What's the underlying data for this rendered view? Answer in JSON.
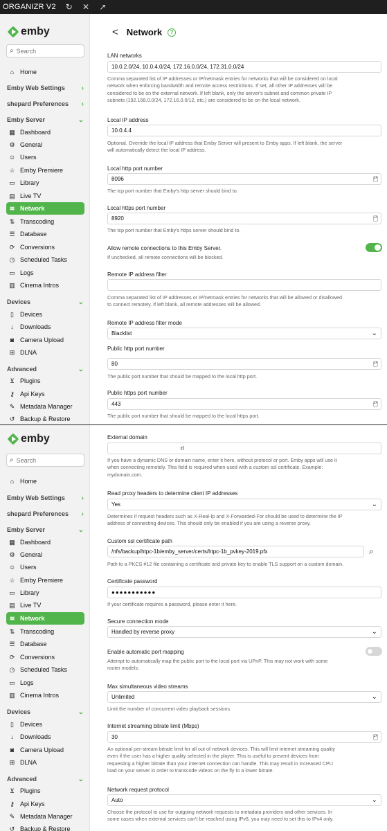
{
  "titlebar": {
    "title": "ORGANIZR V2",
    "reload_icon": "↻",
    "close_icon": "✕",
    "popout_icon": "↗"
  },
  "brand": {
    "name": "emby",
    "color": "#52b54b"
  },
  "search": {
    "placeholder": "Search"
  },
  "nav": {
    "home": "Home",
    "web_settings": "Emby Web Settings",
    "user_prefs": "shepard Preferences",
    "server_header": "Emby Server",
    "dashboard": "Dashboard",
    "general": "General",
    "users": "Users",
    "premiere": "Emby Premiere",
    "library": "Library",
    "livetv": "Live TV",
    "network": "Network",
    "transcoding": "Transcoding",
    "database": "Database",
    "conversions": "Conversions",
    "scheduled": "Scheduled Tasks",
    "logs": "Logs",
    "cinema": "Cinema Intros",
    "devices_header": "Devices",
    "devices": "Devices",
    "downloads": "Downloads",
    "camera": "Camera Upload",
    "dlna": "DLNA",
    "advanced_header": "Advanced",
    "plugins": "Plugins",
    "apikeys": "Api Keys",
    "metadata": "Metadata Manager",
    "backup": "Backup & Restore"
  },
  "page": {
    "title": "Network",
    "back_icon": "<",
    "help_icon": "?"
  },
  "settings": {
    "lan": {
      "label": "LAN networks",
      "value": "10.0.2.0/24, 10.0.4.0/24, 172.16.0.0/24, 172.31.0.0/24",
      "help1": "Comma separated list of IP addresses or IP/netmask entries for networks that will be considered on local",
      "help2": "network when enforcing bandwidth and remote access restrictions. If set, all other IP addresses will be",
      "help3": "considered to be on the external network. If left blank, only the server's subnet and common private IP",
      "help4": "subnets (192.168.0.0/24, 172.16.0.0/12, etc.) are considered to be on the local network."
    },
    "local_ip": {
      "label": "Local IP address",
      "value": "10.0.4.4",
      "help1": "Optional. Override the local IP address that Emby Server will present to Emby apps. If left blank, the server",
      "help2": "will automatically detect the local IP address."
    },
    "http_port": {
      "label": "Local http port number",
      "value": "8096",
      "help": "The tcp port number that Emby's http server should bind to."
    },
    "https_port": {
      "label": "Local https port number",
      "value": "8920",
      "help": "The tcp port number that Emby's https server should bind to."
    },
    "remote": {
      "label": "Allow remote connections to this Emby Server.",
      "help": "If unchecked, all remote connections will be blocked.",
      "enabled": true
    },
    "remote_filter": {
      "label": "Remote IP address filter",
      "value": "",
      "help1": "Comma separated list of IP addresses or IP/netmask entries for networks that will be allowed or disallowed",
      "help2": "to connect remotely. If left blank, all remote addresses will be allowed."
    },
    "filter_mode": {
      "label": "Remote IP address filter mode",
      "value": "Blacklist"
    },
    "public_http": {
      "label": "Public http port number",
      "value": "80",
      "help": "The public port number that should be mapped to the local http port."
    },
    "public_https": {
      "label": "Public https port number",
      "value": "443",
      "help": "The public port number that should be mapped to the local https port."
    },
    "domain": {
      "label": "External domain",
      "value": "rl",
      "help1": "If you have a dynamic DNS or domain name, enter it here, without protocol or port. Emby apps will use it",
      "help2": "when connecting remotely. This field is required when used with a custom ssl certificate. Example:",
      "help3": "mydomain.com."
    },
    "proxy_headers": {
      "label": "Read proxy headers to determine client IP addresses",
      "value": "Yes",
      "help1": "Determines if request headers such as X-Real-Ip and X-Forwarded-For should be used to determine the IP",
      "help2": "address of connecting devices. This should only be enabled if you are using a reverse proxy."
    },
    "ssl_path": {
      "label": "Custom ssl certificate path",
      "value": "/nfs/backup/htpc-1b/emby_server/certs/htpc-1b_pvkey-2019.pfx",
      "help": "Path to a PKCS #12 file containing a certificate and private key to enable TLS support on a custom domain."
    },
    "cert_password": {
      "label": "Certificate password",
      "value": "●●●●●●●●●●●",
      "help": "If your certificate requires a password, please enter it here."
    },
    "secure_mode": {
      "label": "Secure connection mode",
      "value": "Handled by reverse proxy"
    },
    "port_mapping": {
      "label": "Enable automatic port mapping",
      "help1": "Attempt to automatically map the public port to the local port via UPnP. This may not work with some",
      "help2": "router models.",
      "enabled": false
    },
    "max_streams": {
      "label": "Max simultaneous video streams",
      "value": "Unlimited",
      "help": "Limit the number of concurrent video playback sessions."
    },
    "bitrate": {
      "label": "Internet streaming bitrate limit (Mbps)",
      "value": "30",
      "help1": "An optional per-stream bitrate limit for all out of network devices. This will limit internet streaming quality",
      "help2": "even if the user has a higher quality selected in the player. This is useful to prevent devices from",
      "help3": "requesting a higher bitrate than your internet connection can handle. This may result in increased CPU",
      "help4": "load on your server in order to transcode videos on the fly to a lower bitrate."
    },
    "protocol": {
      "label": "Network request protocol",
      "value": "Auto",
      "help1": "Choose the protocol to use for outgoing network requests to metadata providers and other services. In",
      "help2": "some cases when external services can't be reached using IPv6, you may need to set this to IPv4 only."
    }
  }
}
